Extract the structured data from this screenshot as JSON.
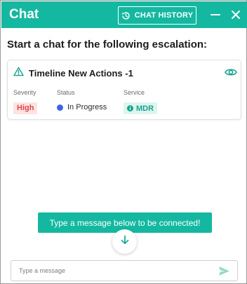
{
  "header": {
    "title": "Chat",
    "history_label": "CHAT HISTORY",
    "icons": [
      "history-icon",
      "minimize-icon",
      "close-icon"
    ]
  },
  "main": {
    "heading": "Start a chat for the following escalation:"
  },
  "escalation": {
    "title": "Timeline New Actions -1",
    "title_icon": "warning-icon",
    "action_icon": "eye-icon",
    "severity_label": "Severity",
    "status_label": "Status",
    "service_label": "Service",
    "severity": "High",
    "status": "In Progress",
    "service": "MDR"
  },
  "chat": {
    "connect_message": "Type a message below to be connected!",
    "scroll_icon": "arrow-down-icon",
    "input_placeholder": "Type a message",
    "send_icon": "send-icon"
  },
  "colors": {
    "accent": "#14b8a0",
    "severity_high_text": "#e04646",
    "severity_high_bg": "#fde3e3",
    "status_in_progress": "#3f63e6",
    "service_text": "#14a58e",
    "service_bg": "#dff4ef"
  }
}
